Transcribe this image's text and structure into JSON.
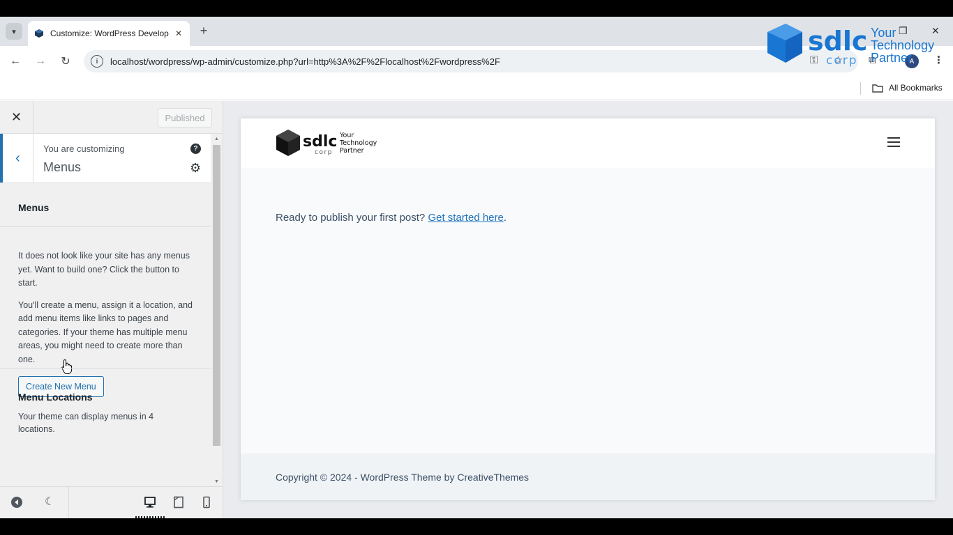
{
  "browser": {
    "tab_title": "Customize: WordPress Develop",
    "url": "localhost/wordpress/wp-admin/customize.php?url=http%3A%2F%2Flocalhost%2Fwordpress%2F",
    "bookmarks_label": "All Bookmarks",
    "profile_initial": "A"
  },
  "watermark": {
    "brand": "sdlc",
    "sub": "corp",
    "tagline_1": "Your",
    "tagline_2": "Technology",
    "tagline_3": "Partner"
  },
  "customizer": {
    "published_label": "Published",
    "customizing_label": "You are customizing",
    "section_title": "Menus",
    "menus_heading": "Menus",
    "desc_1": "It does not look like your site has any menus yet. Want to build one? Click the button to start.",
    "desc_2": "You'll create a menu, assign it a location, and add menu items like links to pages and categories. If your theme has multiple menu areas, you might need to create more than one.",
    "create_button": "Create New Menu",
    "locations_heading": "Menu Locations",
    "locations_desc": "Your theme can display menus in 4 locations."
  },
  "preview": {
    "logo_brand": "sdlc",
    "logo_sub": "corp",
    "logo_tag_1": "Your",
    "logo_tag_2": "Technology",
    "logo_tag_3": "Partner",
    "message_prefix": "Ready to publish your first post?",
    "message_link": "Get started here",
    "message_suffix": ".",
    "copyright": "Copyright © 2024 - WordPress Theme by CreativeThemes"
  },
  "colors": {
    "accent": "#2271b1",
    "watermark_blue": "#1976d2"
  }
}
